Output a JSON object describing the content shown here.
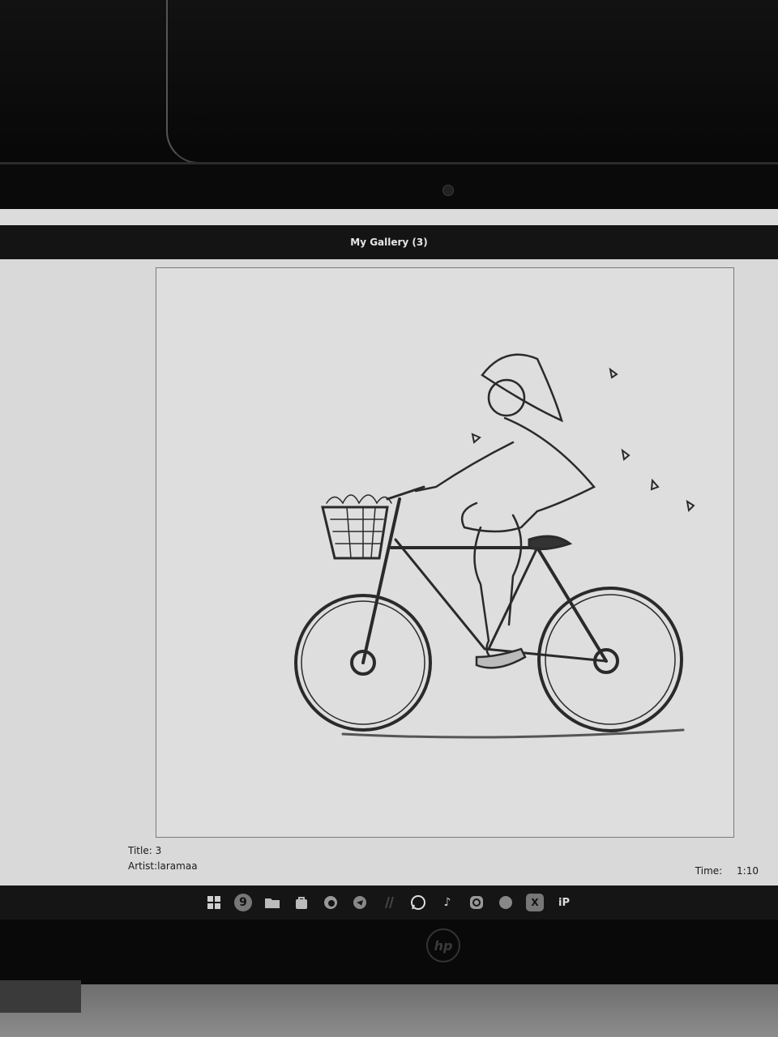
{
  "window": {
    "title": "My Gallery (3)"
  },
  "artwork": {
    "title_line": "Title: 3",
    "artist_line": "Artist:laramaa"
  },
  "playback": {
    "time_label": "Time:",
    "time_value": "1:10"
  },
  "taskbar": {
    "icons": [
      "windows-start-icon",
      "app-g-icon",
      "file-explorer-icon",
      "store-icon",
      "edge-icon",
      "telegram-icon",
      "slash-app-icon",
      "whatsapp-icon",
      "tiktok-icon",
      "instagram-icon",
      "cloud-app-icon",
      "excel-icon",
      "ip-app-icon"
    ],
    "labels": {
      "tiktok": "♪",
      "excel": "X",
      "ip": "iP",
      "g": "9"
    }
  },
  "device": {
    "brand_logo": "hp"
  }
}
